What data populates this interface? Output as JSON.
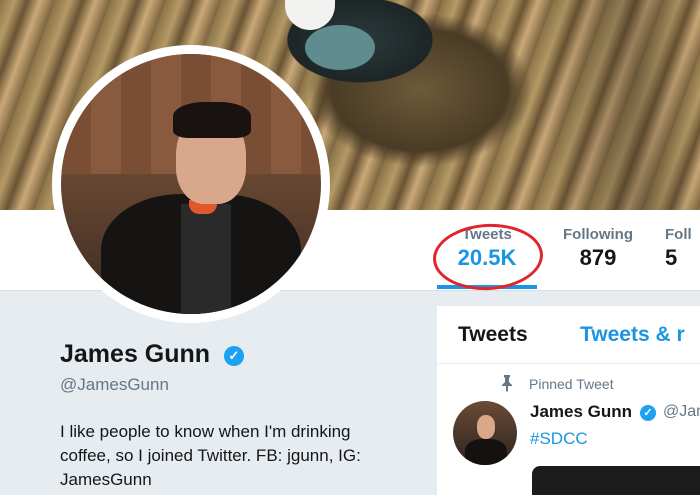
{
  "profile": {
    "name": "James Gunn",
    "handle": "@JamesGunn",
    "bio": "I like people to know when I'm drinking coffee, so I joined Twitter. FB: jgunn, IG: JamesGunn"
  },
  "stats": {
    "tweets_label": "Tweets",
    "tweets_value": "20.5K",
    "following_label": "Following",
    "following_value": "879",
    "followers_label": "Foll",
    "followers_value": "5"
  },
  "timeline": {
    "tab_tweets": "Tweets",
    "tab_replies": "Tweets & r",
    "pinned_label": "Pinned Tweet",
    "tweet_name": "James Gunn",
    "tweet_handle": "@Jam",
    "tweet_text": "#SDCC"
  },
  "icons": {
    "verified": "verified-badge-icon",
    "pin": "pin-icon"
  },
  "colors": {
    "accent": "#1b95e0",
    "verified": "#1da1f2",
    "highlight_circle": "#e0262b",
    "muted": "#657786"
  }
}
